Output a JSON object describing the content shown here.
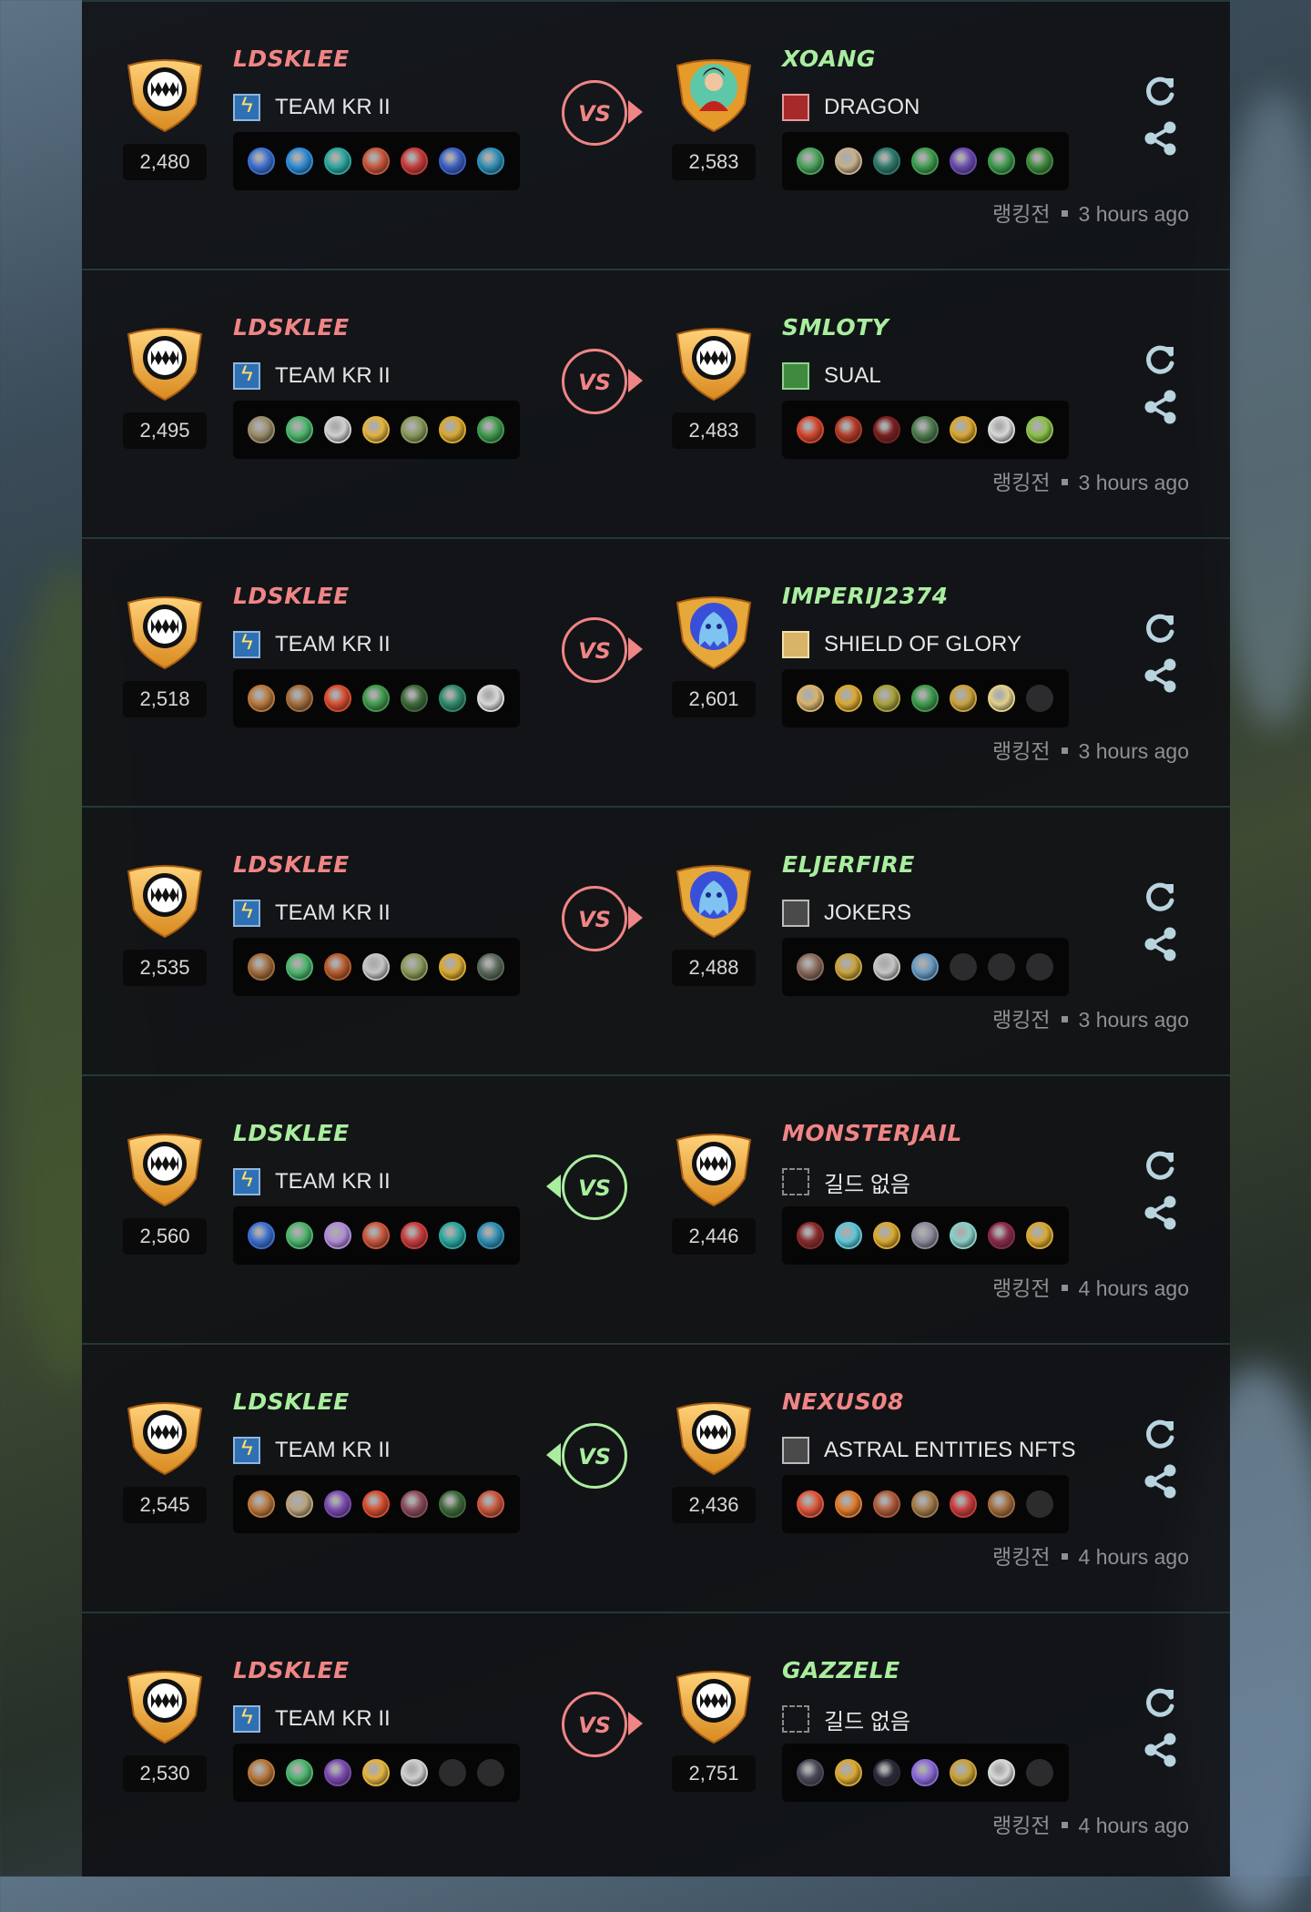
{
  "colors": {
    "win": "#a9ee9f",
    "lose": "#f08585",
    "win_name": "#a9ee9f",
    "lose_name": "#f08585"
  },
  "battles": [
    {
      "result": "lose",
      "player": {
        "name": "LDSKLEE",
        "guild": "TEAM KR II",
        "guild_icon": "blue",
        "rating": "2,480",
        "team": [
          "#3b6fd1",
          "#2c8bd6",
          "#2aa7a0",
          "#c9563a",
          "#c93b3b",
          "#3a5fc6",
          "#2e8fb5"
        ]
      },
      "opponent": {
        "name": "XOANG",
        "guild": "DRAGON",
        "guild_icon": "red",
        "rating": "2,583",
        "avatar": "portrait",
        "team": [
          "#4aa35a",
          "#c7b08a",
          "#2c7a6a",
          "#3e9d4e",
          "#6a4bb0",
          "#3c9a4c",
          "#3e8a3c"
        ]
      },
      "mode": "랭킹전",
      "time": "3 hours ago"
    },
    {
      "result": "lose",
      "player": {
        "name": "LDSKLEE",
        "guild": "TEAM KR II",
        "guild_icon": "blue",
        "rating": "2,495",
        "team": [
          "#9a8c6a",
          "#4bb56c",
          "#d0d0d0",
          "#e3b33e",
          "#8a9a5a",
          "#d9a82f",
          "#3f9a4c"
        ]
      },
      "opponent": {
        "name": "SMLOTY",
        "guild": "SUAL",
        "guild_icon": "green",
        "rating": "2,483",
        "avatar": "fang",
        "team": [
          "#d6452c",
          "#b33a26",
          "#7a1f1f",
          "#4e7a4e",
          "#d9a82f",
          "#d8d8d8",
          "#8cc04a"
        ]
      },
      "mode": "랭킹전",
      "time": "3 hours ago"
    },
    {
      "result": "lose",
      "player": {
        "name": "LDSKLEE",
        "guild": "TEAM KR II",
        "guild_icon": "blue",
        "rating": "2,518",
        "team": [
          "#b8773a",
          "#a36c3c",
          "#d74b2d",
          "#3f9a4c",
          "#3e6a3a",
          "#2f8a6a",
          "#d8d8d8"
        ]
      },
      "opponent": {
        "name": "IMPERIJ2374",
        "guild": "SHIELD OF GLORY",
        "guild_icon": "gold",
        "rating": "2,601",
        "avatar": "ghost",
        "team": [
          "#d7b36a",
          "#d9a82f",
          "#a7a03a",
          "#3f9a4c",
          "#c9a23a",
          "#e2cf8a",
          "empty"
        ]
      },
      "mode": "랭킹전",
      "time": "3 hours ago"
    },
    {
      "result": "lose",
      "player": {
        "name": "LDSKLEE",
        "guild": "TEAM KR II",
        "guild_icon": "blue",
        "rating": "2,535",
        "team": [
          "#a36c3c",
          "#4bb56c",
          "#b85a2a",
          "#c5c5c5",
          "#8a9a5a",
          "#d9a82f",
          "#5a6a5a"
        ]
      },
      "opponent": {
        "name": "ELJERFIRE",
        "guild": "JOKERS",
        "guild_icon": "mono",
        "rating": "2,488",
        "avatar": "ghost",
        "team": [
          "#8a6a5a",
          "#c9a23a",
          "#c5c5c5",
          "#6a9ac0",
          "empty",
          "empty",
          "empty"
        ]
      },
      "mode": "랭킹전",
      "time": "3 hours ago"
    },
    {
      "result": "win",
      "player": {
        "name": "LDSKLEE",
        "guild": "TEAM KR II",
        "guild_icon": "blue",
        "rating": "2,560",
        "team": [
          "#3b6fd1",
          "#4bb56c",
          "#b08ad8",
          "#c9563a",
          "#c93b3b",
          "#2aa7a0",
          "#2e8fb5"
        ]
      },
      "opponent": {
        "name": "MONSTERJAIL",
        "guild": "길드 없음",
        "guild_icon": "none",
        "rating": "2,446",
        "avatar": "fang",
        "team": [
          "#8a2a2a",
          "#5cc7d8",
          "#d9a82f",
          "#8a8a9a",
          "#88d0c8",
          "#8a2a4a",
          "#d9a82f"
        ]
      },
      "mode": "랭킹전",
      "time": "4 hours ago"
    },
    {
      "result": "win",
      "player": {
        "name": "LDSKLEE",
        "guild": "TEAM KR II",
        "guild_icon": "blue",
        "rating": "2,545",
        "team": [
          "#b8773a",
          "#b9a27a",
          "#7a4ab0",
          "#d74b2d",
          "#8a4a5a",
          "#3e6a3a",
          "#c9563a"
        ]
      },
      "opponent": {
        "name": "NEXUS08",
        "guild": "ASTRAL ENTITIES NFTS",
        "guild_icon": "mono",
        "rating": "2,436",
        "avatar": "fang",
        "team": [
          "#e0553a",
          "#e07a2a",
          "#b05a3a",
          "#a37a4a",
          "#c93b3b",
          "#a36c3c",
          "empty"
        ]
      },
      "mode": "랭킹전",
      "time": "4 hours ago"
    },
    {
      "result": "lose",
      "player": {
        "name": "LDSKLEE",
        "guild": "TEAM KR II",
        "guild_icon": "blue",
        "rating": "2,530",
        "team": [
          "#b8773a",
          "#4bb56c",
          "#7a4ab0",
          "#e3b33e",
          "#d0d0d0",
          "empty",
          "empty"
        ]
      },
      "opponent": {
        "name": "GAZZELE",
        "guild": "길드 없음",
        "guild_icon": "none",
        "rating": "2,751",
        "avatar": "fang",
        "team": [
          "#4a4a5a",
          "#d9a82f",
          "#2a2a3a",
          "#8a6ad8",
          "#c9a23a",
          "#d8d8d8",
          "empty"
        ]
      },
      "mode": "랭킹전",
      "time": "4 hours ago"
    }
  ]
}
